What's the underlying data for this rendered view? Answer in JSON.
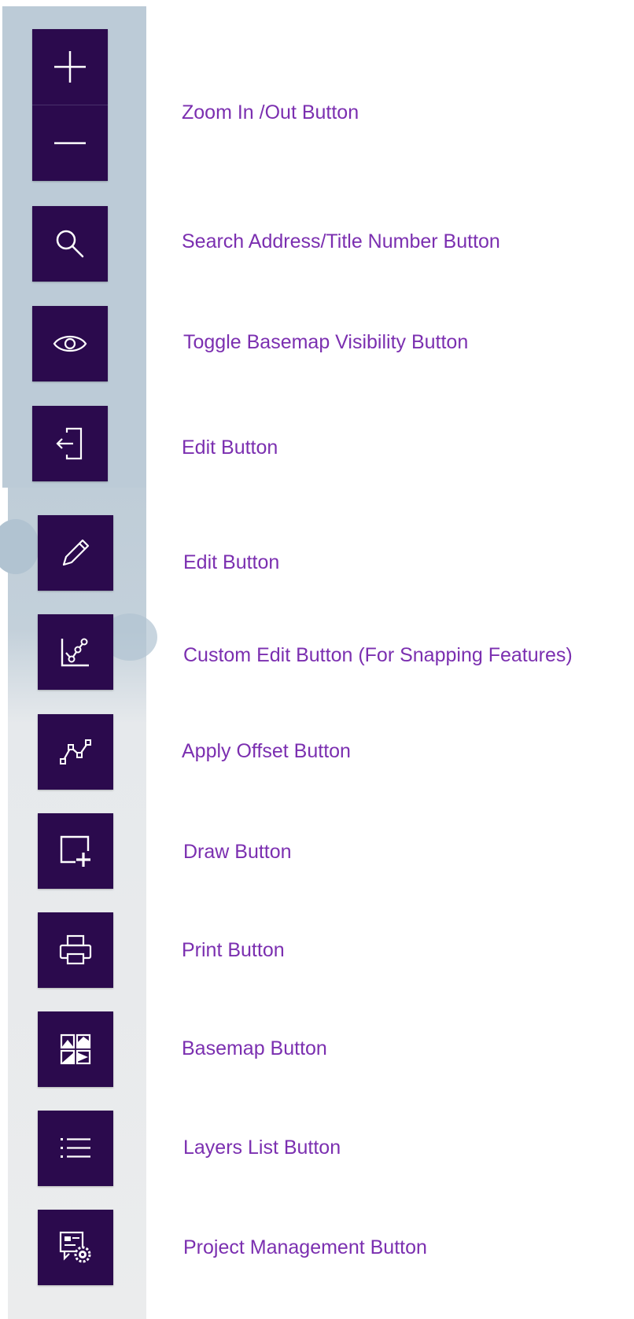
{
  "colors": {
    "button_bg": "#2b0a4d",
    "icon": "#ffffff",
    "label_text": "#7b2fb0",
    "map_water": "#bccbd7",
    "map_land": "#ebeced"
  },
  "buttons": [
    {
      "id": "zoom",
      "icons": [
        "plus-icon",
        "minus-icon"
      ],
      "label": "Zoom In /Out Button"
    },
    {
      "id": "search",
      "icon": "search-icon",
      "label": "Search Address/Title Number Button"
    },
    {
      "id": "toggle-basemap",
      "icon": "eye-icon",
      "label": "Toggle Basemap Visibility Button"
    },
    {
      "id": "edit-entry",
      "icon": "enter-icon",
      "label": "Edit Button"
    },
    {
      "id": "edit",
      "icon": "pencil-icon",
      "label": "Edit Button"
    },
    {
      "id": "custom-edit",
      "icon": "snapping-chart-icon",
      "label": "Custom Edit Button (For Snapping Features)"
    },
    {
      "id": "apply-offset",
      "icon": "polyline-icon",
      "label": "Apply Offset Button"
    },
    {
      "id": "draw",
      "icon": "add-shape-icon",
      "label": "Draw Button"
    },
    {
      "id": "print",
      "icon": "printer-icon",
      "label": "Print Button"
    },
    {
      "id": "basemap",
      "icon": "basemap-gallery-icon",
      "label": "Basemap Button"
    },
    {
      "id": "layers-list",
      "icon": "list-icon",
      "label": "Layers List Button"
    },
    {
      "id": "project-management",
      "icon": "project-gear-icon",
      "label": "Project Management Button"
    }
  ]
}
